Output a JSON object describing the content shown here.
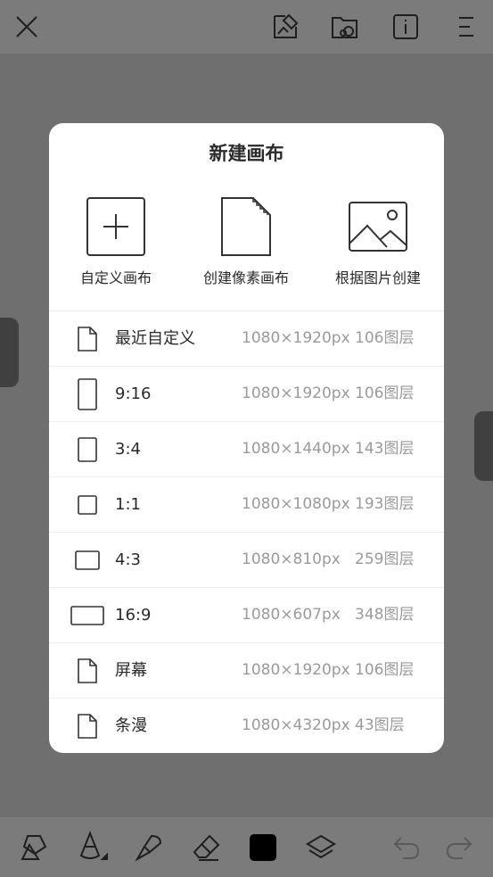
{
  "dialog": {
    "title": "新建画布",
    "options": [
      {
        "label": "自定义画布",
        "icon": "plus-square-icon"
      },
      {
        "label": "创建像素画布",
        "icon": "pixel-document-icon"
      },
      {
        "label": "根据图片创建",
        "icon": "image-icon"
      }
    ],
    "presets": [
      {
        "name": "最近自定义",
        "size": "1080×1920px",
        "layers": "106图层",
        "icon": "document-icon"
      },
      {
        "name": "9:16",
        "size": "1080×1920px",
        "layers": "106图层",
        "icon": "ratio-9-16-icon"
      },
      {
        "name": "3:4",
        "size": "1080×1440px",
        "layers": "143图层",
        "icon": "ratio-3-4-icon"
      },
      {
        "name": "1:1",
        "size": "1080×1080px",
        "layers": "193图层",
        "icon": "ratio-1-1-icon"
      },
      {
        "name": "4:3",
        "size": "1080×810px",
        "layers": "259图层",
        "icon": "ratio-4-3-icon"
      },
      {
        "name": "16:9",
        "size": "1080×607px",
        "layers": "348图层",
        "icon": "ratio-16-9-icon"
      },
      {
        "name": "屏幕",
        "size": "1080×1920px",
        "layers": "106图层",
        "icon": "document-icon"
      },
      {
        "name": "条漫",
        "size": "1080×4320px",
        "layers": "43图层",
        "icon": "document-icon"
      }
    ]
  },
  "topbar": {
    "icons": [
      "close-icon",
      "gallery-icon",
      "folder-cloud-icon",
      "info-icon",
      "menu-icon"
    ]
  },
  "bottombar": {
    "icons": [
      "shapes-icon",
      "pencil-icon",
      "brush-icon",
      "eraser-icon",
      "color-swatch-icon",
      "layers-icon",
      "undo-icon",
      "redo-icon"
    ],
    "color_swatch": "#000000"
  }
}
